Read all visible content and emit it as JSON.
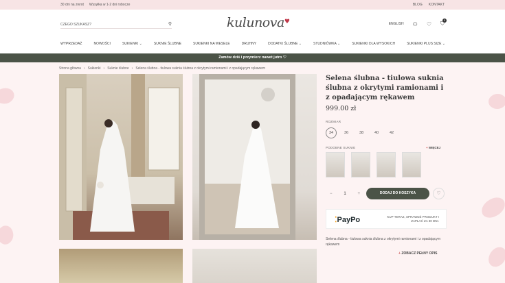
{
  "topbar": {
    "left": [
      "30 dni na zwrot",
      "Wysyłka w 1-2 dni robocze"
    ],
    "right": [
      "BLOG",
      "KONTAKT"
    ]
  },
  "header": {
    "search_placeholder": "CZEGO SZUKASZ?",
    "logo": "kulunova",
    "language": "ENGLISH",
    "cart_count": "0"
  },
  "nav": [
    "WYPRZEDAŻ",
    "NOWOŚCI",
    "SUKIENKI",
    "SUKNIE ŚLUBNE",
    "SUKIENKI NA WESELE",
    "DRUHNY",
    "DODATKI ŚLUBNE",
    "STUDNIÓWKA",
    "SUKIENKI DLA WYSOKICH",
    "SUKIENKI PLUS SIZE"
  ],
  "banner": "Zamów dziś i przymierz nawet jutro ♡",
  "breadcrumb": [
    "Strona główna",
    "Sukienki",
    "Suknie ślubne",
    "Selena ślubna - tiulowa suknia ślubna z okrytymi ramionami i z opadającym rękawem"
  ],
  "product": {
    "title": "Selena ślubna - tiulowa suknia ślubna z okrytymi ramionami i z opadającym rękawem",
    "price": "999.00 zł",
    "size_label": "ROZMIAR",
    "sizes": [
      "34",
      "36",
      "38",
      "40",
      "42"
    ],
    "selected_size": "34",
    "similar_label": "PODOBNE SUKNIE",
    "more_label": "WIĘCEJ",
    "qty_minus": "−",
    "qty_value": "1",
    "qty_plus": "+",
    "add_to_cart": "DODAJ DO KOSZYKA",
    "paypo_logo": "PayPo",
    "paypo_text": "KUP TERAZ, SPRAWDŹ PRODUKT I ZAPŁAĆ ZA 30 DNI.",
    "description": "Selena ślubna - tiulowa suknia ślubna z okrytymi ramionami i z opadającym rękawem",
    "full_description": "ZOBACZ PEŁNY OPIS"
  }
}
